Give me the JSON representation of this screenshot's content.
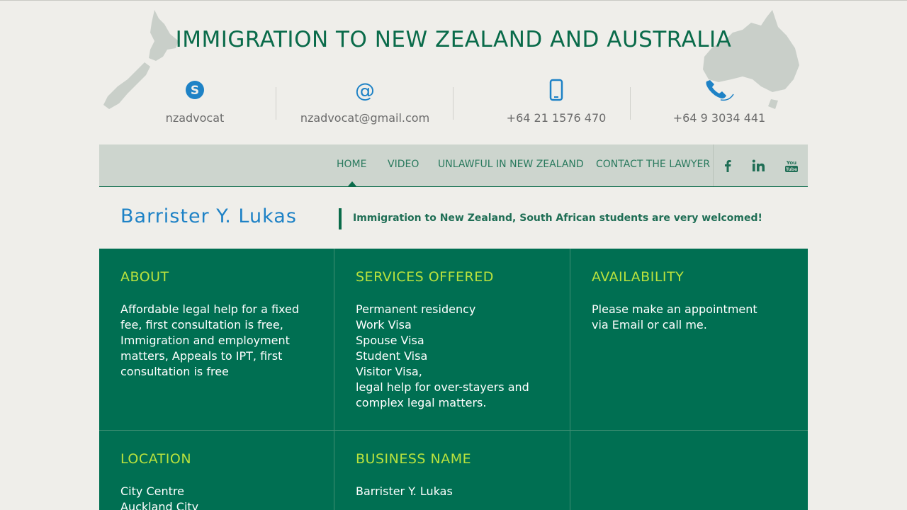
{
  "header": {
    "title": "IMMIGRATION TO NEW ZEALAND AND AUSTRALIA",
    "contacts": [
      {
        "icon": "skype-icon",
        "text": "nzadvocat"
      },
      {
        "icon": "at-icon",
        "text": "nzadvocat@gmail.com"
      },
      {
        "icon": "mobile-phone-icon",
        "text": "+64 21 1576 470"
      },
      {
        "icon": "phone-handset-icon",
        "text": "+64 9 3034 441"
      }
    ]
  },
  "nav": {
    "items": [
      "HOME",
      "VIDEO",
      "UNLAWFUL IN NEW ZEALAND",
      "CONTACT THE LAWYER"
    ],
    "active": "HOME",
    "social": [
      "facebook-icon",
      "linkedin-icon",
      "youtube-icon"
    ]
  },
  "intro": {
    "name": "Barrister Y. Lukas",
    "tagline": "Immigration to New Zealand, South African students are very welcomed!"
  },
  "sections": {
    "about": {
      "heading": "ABOUT",
      "text": "Affordable legal help for a fixed fee, first consultation is free, Immigration and employment matters, Appeals to IPT, first consultation is free"
    },
    "services": {
      "heading": "SERVICES OFFERED",
      "lines": [
        "Permanent residency",
        "Work Visa",
        "Spouse Visa",
        "Student Visa",
        "Visitor Visa,",
        "legal help for over-stayers and complex legal matters."
      ]
    },
    "availability": {
      "heading": "AVAILABILITY",
      "text": "Please make an appointment via Email or call me."
    },
    "location": {
      "heading": "LOCATION",
      "lines": [
        "City Centre",
        "Auckland City"
      ]
    },
    "business": {
      "heading": "BUSINESS NAME",
      "lines": [
        "Barrister Y. Lukas"
      ]
    }
  },
  "colors": {
    "brand_green": "#006f52",
    "heading_lime": "#b9e23d",
    "name_blue": "#1e82c6",
    "icon_blue": "#1e82c6",
    "page_bg": "#efeeea",
    "nav_bg": "#cdd5ce"
  }
}
